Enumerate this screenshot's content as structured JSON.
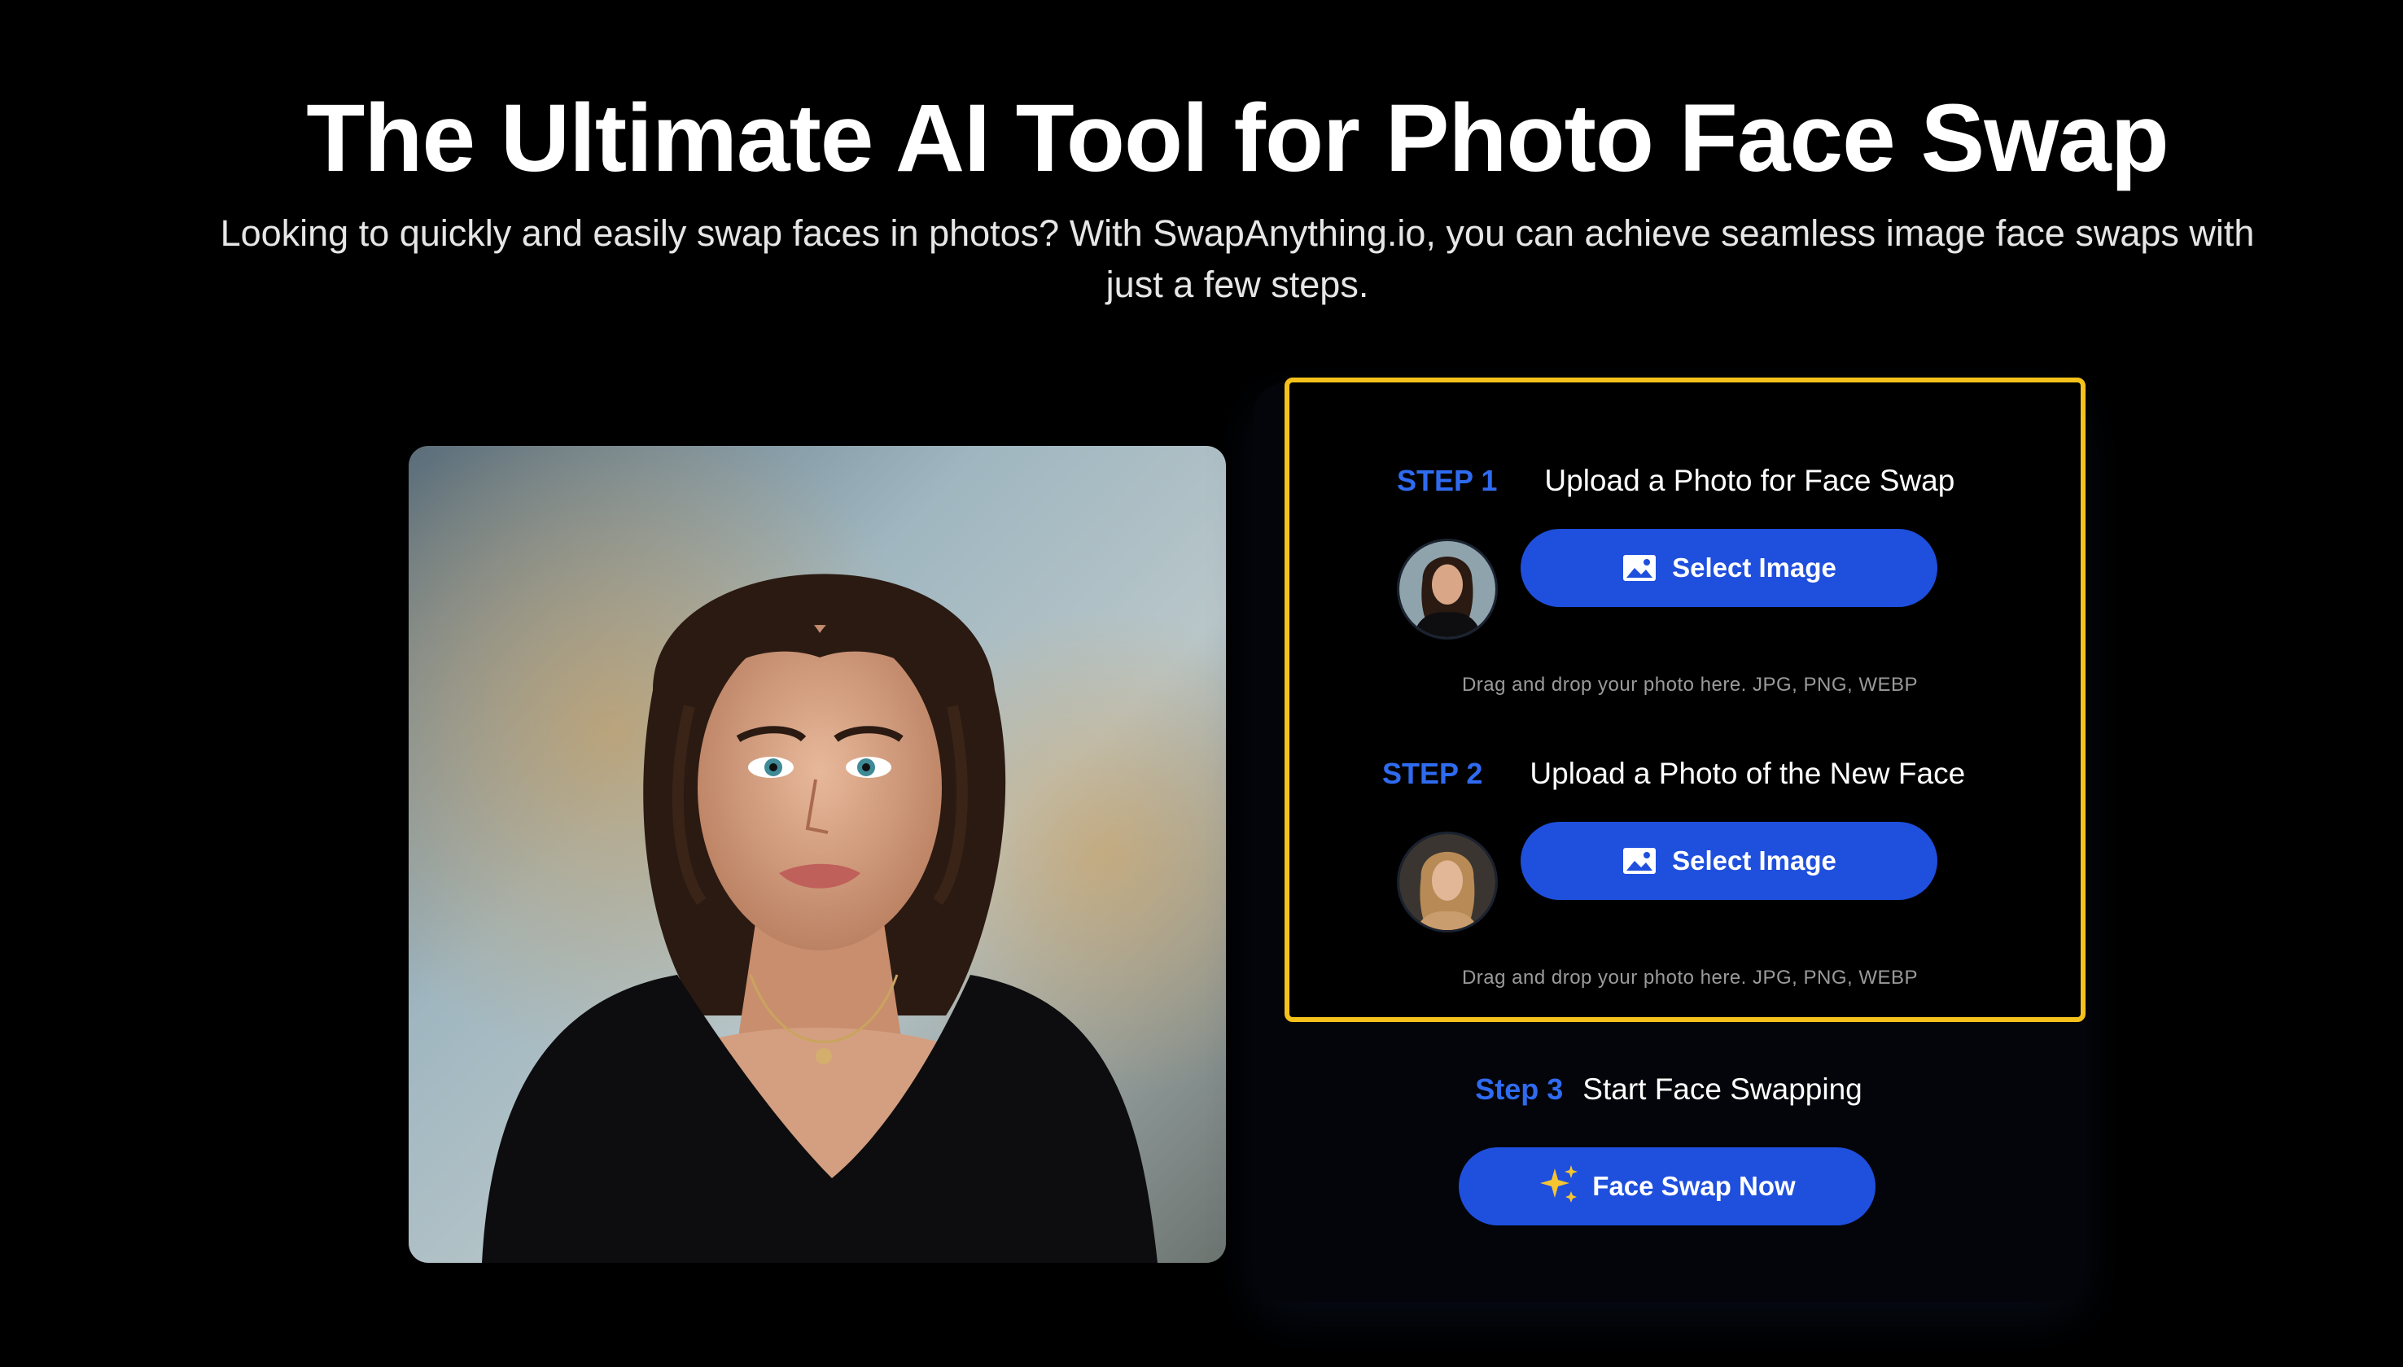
{
  "header": {
    "title": "The Ultimate AI Tool for Photo Face Swap",
    "subtitle": "Looking to quickly and easily swap faces in photos? With SwapAnything.io, you can achieve seamless image face swaps with just a few steps."
  },
  "preview": {
    "icon": "portrait-woman-black-top-image"
  },
  "steps": [
    {
      "label": "STEP 1",
      "text": "Upload a Photo for Face Swap",
      "button_label": "Select Image",
      "hint": "Drag and drop your photo here. JPG, PNG, WEBP",
      "thumbnail_icon": "woman-dark-hair-thumbnail"
    },
    {
      "label": "STEP 2",
      "text": "Upload a Photo of the New Face",
      "button_label": "Select Image",
      "hint": "Drag and drop your photo here. JPG, PNG, WEBP",
      "thumbnail_icon": "woman-blonde-hair-thumbnail"
    }
  ],
  "step3": {
    "label": "Step 3",
    "text": "Start Face Swapping",
    "button_label": "Face Swap Now",
    "button_icon": "sparkles-icon"
  },
  "colors": {
    "background": "#000000",
    "accent_blue": "#1f4fdd",
    "step_label_blue": "#2f6bf0",
    "highlight_border": "#f5c21b",
    "hint_gray": "#9a9a9a"
  }
}
